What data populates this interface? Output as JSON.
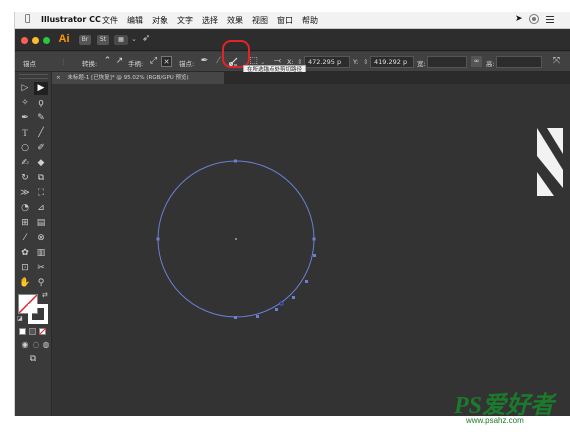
{
  "menubar": {
    "app_name": "Illustrator CC",
    "items": [
      "文件",
      "编辑",
      "对象",
      "文字",
      "选择",
      "效果",
      "视图",
      "窗口",
      "帮助"
    ]
  },
  "appbar": {
    "logo": "Ai",
    "btn_br": "Br",
    "btn_st": "St"
  },
  "controlbar": {
    "label_anchor_point": "锚点",
    "label_convert": "转换:",
    "label_handle": "手柄:",
    "label_anchor": "锚点:",
    "x_label": "X:",
    "x_value": "472.295 p",
    "y_label": "Y:",
    "y_value": "419.292 p",
    "w_label": "宽:",
    "h_label": "高:",
    "tooltip": "在所选锚点处剪切路径"
  },
  "document": {
    "tab_title": "未标题-1 [已恢复]* @ 95.02% (RGB/GPU 预览)",
    "close_glyph": "×"
  },
  "watermark": {
    "logo": "PS爱好者",
    "url": "www.psahz.com"
  },
  "colors": {
    "highlight": "#e0242a",
    "path": "#6b7fd4",
    "canvas": "#333333"
  }
}
